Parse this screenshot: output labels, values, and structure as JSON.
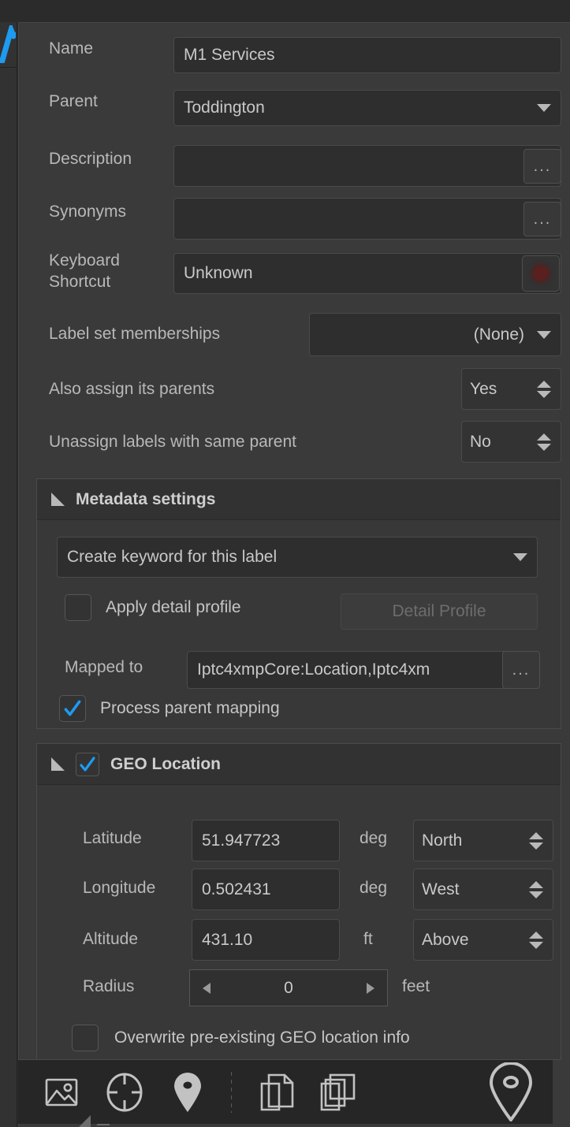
{
  "form": {
    "name": {
      "label": "Name",
      "value": "M1 Services"
    },
    "parent": {
      "label": "Parent",
      "value": "Toddington"
    },
    "description": {
      "label": "Description",
      "value": "",
      "more": "..."
    },
    "synonyms": {
      "label": "Synonyms",
      "value": "",
      "more": "..."
    },
    "keyboard_shortcut": {
      "label_line1": "Keyboard",
      "label_line2": "Shortcut",
      "value": "Unknown"
    },
    "label_set_memberships": {
      "label": "Label set memberships",
      "value": "(None)"
    },
    "also_assign_parents": {
      "label": "Also assign its parents",
      "value": "Yes"
    },
    "unassign_same_parent": {
      "label": "Unassign labels with same parent",
      "value": "No"
    }
  },
  "metadata": {
    "title": "Metadata settings",
    "keyword_mode": "Create keyword for this label",
    "apply_detail_profile": {
      "label": "Apply detail profile",
      "checked": false
    },
    "detail_profile_button": "Detail Profile",
    "mapped_to": {
      "label": "Mapped to",
      "value": "Iptc4xmpCore:Location,Iptc4xm",
      "more": "..."
    },
    "process_parent_mapping": {
      "label": "Process parent mapping",
      "checked": true
    }
  },
  "geo": {
    "title": "GEO Location",
    "enabled": true,
    "latitude": {
      "label": "Latitude",
      "value": "51.947723",
      "unit": "deg",
      "hemisphere": "North"
    },
    "longitude": {
      "label": "Longitude",
      "value": "0.502431",
      "unit": "deg",
      "hemisphere": "West"
    },
    "altitude": {
      "label": "Altitude",
      "value": "431.10",
      "unit": "ft",
      "reference": "Above"
    },
    "radius": {
      "label": "Radius",
      "value": "0",
      "unit": "feet"
    },
    "overwrite": {
      "label": "Overwrite pre-existing GEO location info",
      "checked": false
    }
  },
  "toolbar": {
    "icons": [
      {
        "name": "image-icon",
        "active": true
      },
      {
        "name": "crosshair-target-icon",
        "active": false
      },
      {
        "name": "map-pin-filled-icon",
        "active": false
      },
      {
        "name": "copy-pages-icon",
        "active": false
      },
      {
        "name": "copy-layers-icon",
        "active": false
      },
      {
        "name": "map-pin-outline-icon",
        "active": false
      }
    ]
  },
  "colors": {
    "panel_bg": "#3a3a3a",
    "field_bg": "#2e2e2e",
    "accent_blue": "#1e9bf0",
    "record_red": "#5a1f1f",
    "text": "#c9c9c9",
    "label_text": "#b8b8b8"
  }
}
